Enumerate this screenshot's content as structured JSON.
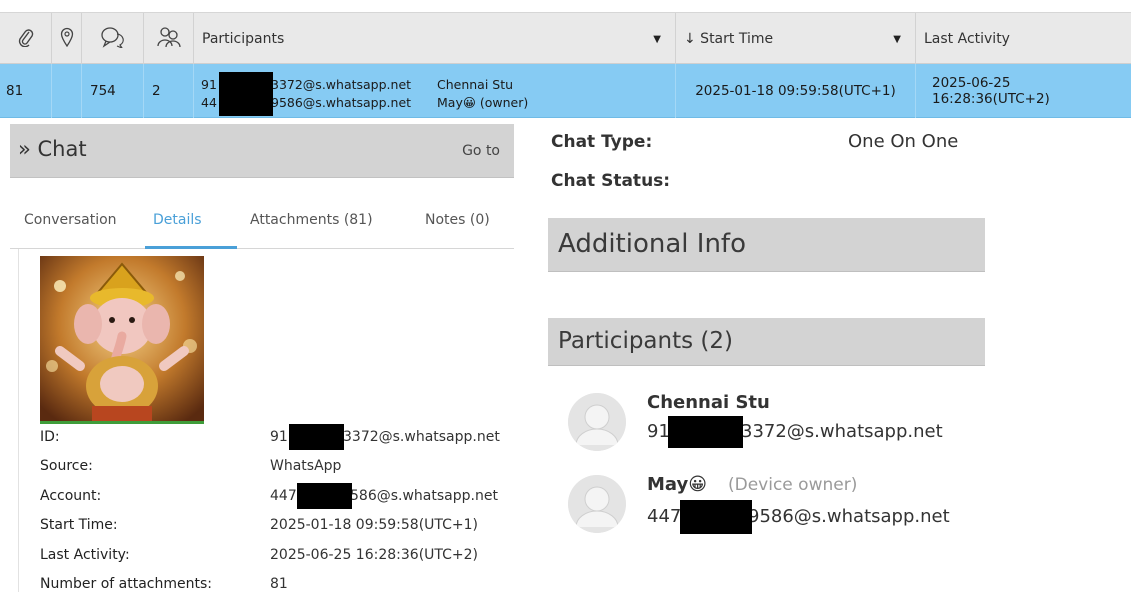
{
  "grid": {
    "headers": {
      "participants": "Participants",
      "start_time": "↓ Start Time",
      "last_activity": "Last Activity"
    },
    "row": {
      "index": "81",
      "messages": "754",
      "participant_count": "2",
      "participant1_prefix": "91",
      "participant1_suffix": "3372@s.whatsapp.net",
      "participant1_name": "Chennai Stu",
      "participant2_prefix": "44",
      "participant2_suffix": "9586@s.whatsapp.net",
      "participant2_name": "May😀 (owner)",
      "start_time": "2025-01-18 09:59:58(UTC+1)",
      "last_activity": "2025-06-25 16:28:36(UTC+2)"
    }
  },
  "chat_panel": {
    "title": "» Chat",
    "goto": "Go to",
    "tabs": [
      "Conversation",
      "Details",
      "Attachments (81)",
      "Notes (0)"
    ],
    "active_tab": "Details",
    "details": {
      "labels": [
        "ID:",
        "Source:",
        "Account:",
        "Start Time:",
        "Last Activity:",
        "Number of attachments:"
      ],
      "id_prefix": "91",
      "id_suffix": "3372@s.whatsapp.net",
      "source": "WhatsApp",
      "account_prefix": "447",
      "account_suffix": "586@s.whatsapp.net",
      "start_time": "2025-01-18 09:59:58(UTC+1)",
      "last_activity": "2025-06-25 16:28:36(UTC+2)",
      "attachments": "81"
    }
  },
  "info_panel": {
    "chat_type_label": "Chat Type:",
    "chat_type_value": "One On One",
    "chat_status_label": "Chat Status:",
    "additional_info": "Additional Info",
    "participants_title": "Participants (2)",
    "participants": [
      {
        "name": "Chennai Stu",
        "jid_prefix": "91",
        "jid_suffix": "3372@s.whatsapp.net",
        "owner": ""
      },
      {
        "name": "May😀",
        "jid_prefix": "447",
        "jid_suffix": "9586@s.whatsapp.net",
        "owner": "(Device owner)"
      }
    ]
  },
  "colors": {
    "selected_row": "#86cbf3",
    "header_bg": "#e9e9e9",
    "section_bg": "#d3d3d3",
    "active_tab": "#4aa0d8",
    "redaction": "#000000"
  },
  "icons": [
    "paperclip-icon",
    "location-pin-icon",
    "chat-bubble-icon",
    "group-icon",
    "sort-caret-icon",
    "contact-avatar-icon"
  ]
}
